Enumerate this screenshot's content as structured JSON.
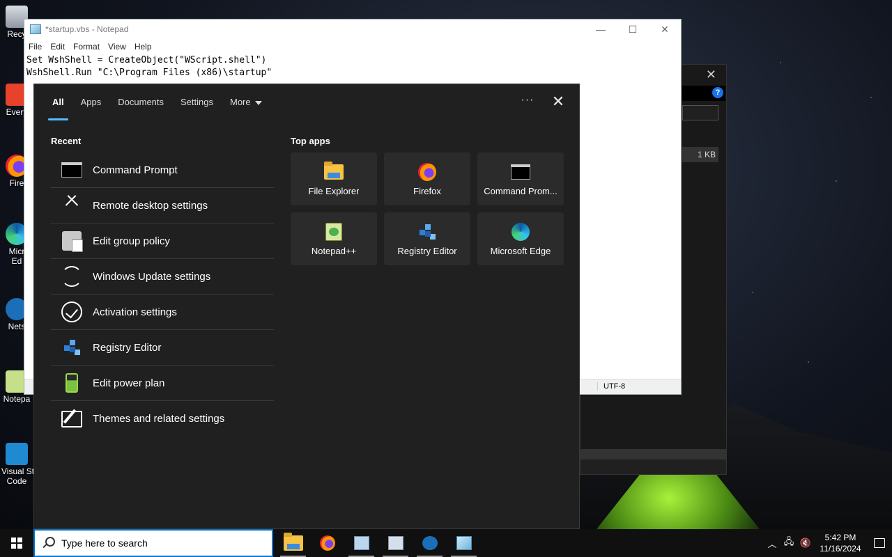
{
  "desktop": {
    "icons": [
      {
        "label": "Recy",
        "icon": "recycle-bin-icon"
      },
      {
        "label": "Every",
        "icon": "everything-icon"
      },
      {
        "label": "Fire",
        "icon": "firefox-icon"
      },
      {
        "label": "Micr\nEd",
        "icon": "edge-icon"
      },
      {
        "label": "Nets",
        "icon": "netsetman-icon"
      },
      {
        "label": "Notepa",
        "icon": "notepadpp-icon"
      },
      {
        "label": "Visual St\nCode",
        "icon": "vscode-icon"
      }
    ]
  },
  "notepad": {
    "title": "*startup.vbs - Notepad",
    "menu": [
      "File",
      "Edit",
      "Format",
      "View",
      "Help"
    ],
    "lines": [
      "Set WshShell = CreateObject(\"WScript.shell\")",
      "WshShell.Run \"C:\\Program Files (x86)\\startup\""
    ],
    "encoding": "UTF-8"
  },
  "explorer": {
    "size": "1 KB"
  },
  "search": {
    "tabs": [
      "All",
      "Apps",
      "Documents",
      "Settings",
      "More"
    ],
    "active_tab": "All",
    "more_options": "···",
    "recent_title": "Recent",
    "recent": [
      {
        "label": "Command Prompt",
        "icon": "command-prompt-icon"
      },
      {
        "label": "Remote desktop settings",
        "icon": "remote-desktop-icon"
      },
      {
        "label": "Edit group policy",
        "icon": "group-policy-icon"
      },
      {
        "label": "Windows Update settings",
        "icon": "windows-update-icon"
      },
      {
        "label": "Activation settings",
        "icon": "activation-icon"
      },
      {
        "label": "Registry Editor",
        "icon": "registry-editor-icon"
      },
      {
        "label": "Edit power plan",
        "icon": "power-plan-icon"
      },
      {
        "label": "Themes and related settings",
        "icon": "themes-icon"
      }
    ],
    "top_apps_title": "Top apps",
    "top_apps": [
      {
        "label": "File Explorer",
        "icon": "file-explorer-icon"
      },
      {
        "label": "Firefox",
        "icon": "firefox-icon"
      },
      {
        "label": "Command Prom...",
        "icon": "command-prompt-icon"
      },
      {
        "label": "Notepad++",
        "icon": "notepadpp-icon"
      },
      {
        "label": "Registry Editor",
        "icon": "registry-editor-icon"
      },
      {
        "label": "Microsoft Edge",
        "icon": "edge-icon"
      }
    ]
  },
  "taskbar": {
    "search_placeholder": "Type here to search",
    "apps": [
      {
        "name": "file-explorer",
        "running": true
      },
      {
        "name": "firefox",
        "running": false
      },
      {
        "name": "task-scheduler",
        "running": true
      },
      {
        "name": "system-config",
        "running": true
      },
      {
        "name": "netsetman",
        "running": true
      },
      {
        "name": "notepad",
        "running": true
      }
    ],
    "time": "5:42 PM",
    "date": "11/16/2024"
  }
}
